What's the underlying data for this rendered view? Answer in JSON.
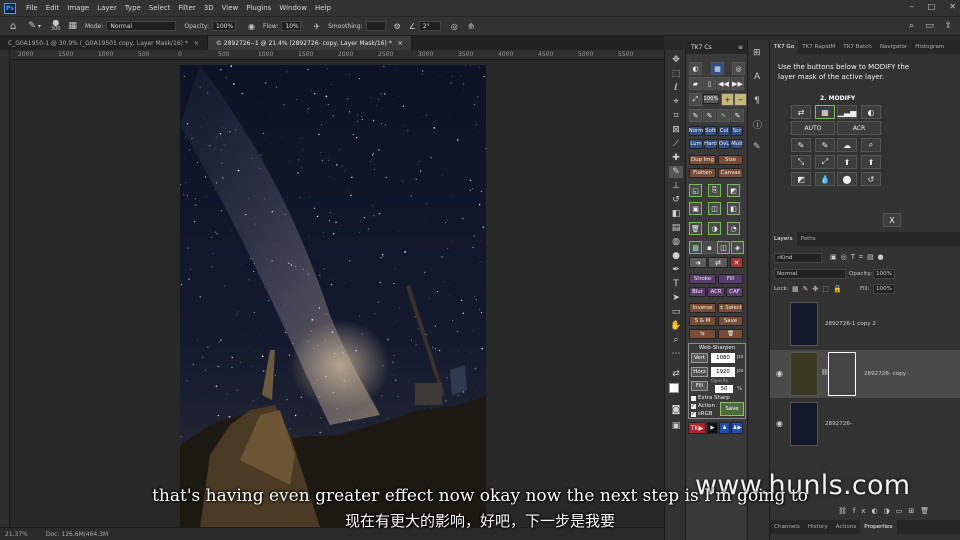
{
  "app": {
    "logo": "Ps",
    "menus": [
      "File",
      "Edit",
      "Image",
      "Layer",
      "Type",
      "Select",
      "Filter",
      "3D",
      "View",
      "Plugins",
      "Window",
      "Help"
    ]
  },
  "options": {
    "brush_size": "300",
    "mode_label": "Mode:",
    "mode_value": "Normal",
    "opacity_label": "Opacity:",
    "opacity_value": "100%",
    "flow_label": "Flow:",
    "flow_value": "10%",
    "smoothing_label": "Smoothing:",
    "angle_value": "2°"
  },
  "tabs": [
    {
      "label": "C_G0A1950-1 @ 30.9% (_G0A19501 copy, Layer Mask/16) *"
    },
    {
      "label": "© 2892726--1 @ 21.4% (2892726- copy, Layer Mask/16) *"
    }
  ],
  "ruler_h": [
    "2000",
    "1500",
    "1000",
    "500",
    "0",
    "500",
    "1000",
    "1500",
    "2000",
    "2500",
    "3000",
    "3500",
    "4000",
    "4500",
    "5000",
    "5500"
  ],
  "status": {
    "zoom": "21.37%",
    "doc": "Doc: 126.6M/464.3M"
  },
  "tk7": {
    "title": "TK7 Cs",
    "blend_row1": [
      "Norm",
      "Soft",
      "Col",
      "Scr"
    ],
    "blend_row2": [
      "Lum",
      "Hard",
      "OvL",
      "Mult"
    ],
    "dup": "Dup Img",
    "size": "Size",
    "flatten": "Flatten",
    "canvas": "Canvas",
    "stroke": "Stroke",
    "fill": "Fill",
    "blur": "Blur",
    "acr": "ACR",
    "caf": "CAF",
    "inverse": "Inverse",
    "select": "± Select",
    "sm": "S & M",
    "save": "Save",
    "zoom": "100%",
    "ws": {
      "title": "Web-Sharpen",
      "vert": "Vert",
      "vert_val": "1080",
      "horz": "Horz",
      "horz_val": "1920",
      "px": "px",
      "fill": "Fill",
      "opacity": "Opacity",
      "opacity_val": "50",
      "pct": "%",
      "extra": "Extra Sharp",
      "action": "Action",
      "srgb": "sRGB",
      "save": "Save"
    },
    "tk_footer": "TK"
  },
  "right_tabs": [
    "TK7 Go",
    "TK7 RapidM",
    "TK7 Batch",
    "Navigator",
    "Histogram"
  ],
  "go": {
    "instructions": "Use the buttons below to MODIFY the layer mask of the active layer.",
    "heading": "2. MODIFY",
    "auto": "AUTO",
    "acr": "ACR",
    "close": "X"
  },
  "layers_tabs": [
    "Layers",
    "Paths"
  ],
  "layers": {
    "kind": "Kind",
    "blend": "Normal",
    "opacity_label": "Opacity:",
    "opacity": "100%",
    "lock_label": "Lock:",
    "fill_label": "Fill:",
    "fill": "100%",
    "items": [
      {
        "name": "2892726-1 copy 2"
      },
      {
        "name": "2892726- copy"
      },
      {
        "name": "2892726-"
      }
    ]
  },
  "bottom_tabs": [
    "Channels",
    "History",
    "Actions",
    "Properties"
  ],
  "watermark": "www.hunls.com",
  "subtitles": {
    "en": "that's having even greater effect now okay now the next step is I'm going to",
    "zh": "现在有更大的影响，好吧，下一步是我要"
  }
}
